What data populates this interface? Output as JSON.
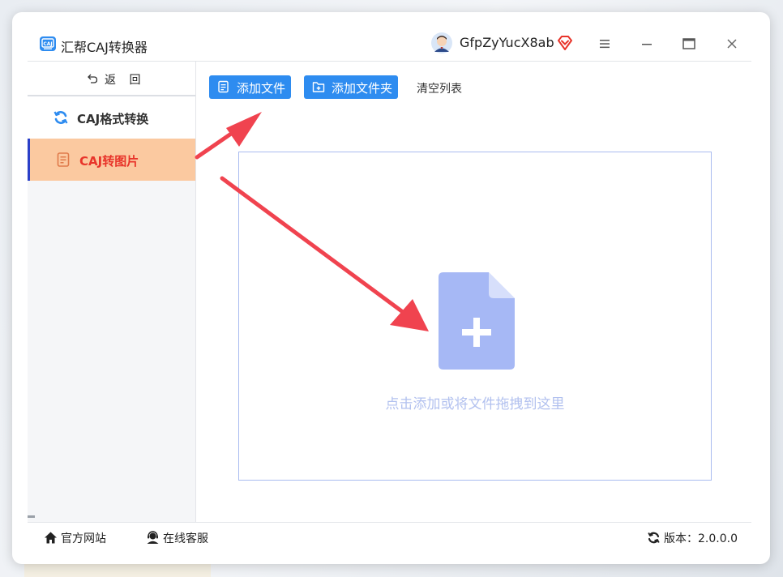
{
  "app": {
    "title": "汇帮CAJ转换器"
  },
  "user": {
    "name": "GfpZyYucX8ab"
  },
  "sidebar": {
    "back_label": "返 回",
    "items": [
      {
        "label": "CAJ格式转换",
        "icon": "refresh-icon",
        "active": false
      },
      {
        "label": "CAJ转图片",
        "icon": "document-icon",
        "active": true
      }
    ]
  },
  "toolbar": {
    "add_file_label": "添加文件",
    "add_folder_label": "添加文件夹",
    "clear_label": "清空列表"
  },
  "dropzone": {
    "text": "点击添加或将文件拖拽到这里"
  },
  "footer": {
    "site_label": "官方网站",
    "service_label": "在线客服",
    "version_label": "版本：2.0.0.0"
  },
  "colors": {
    "accent": "#2e8cf0",
    "active_item_bg": "#fbc9a0",
    "active_item_text": "#e8342a",
    "dropzone_icon": "#a6b8f5",
    "annotation_arrow": "#f0434f"
  }
}
